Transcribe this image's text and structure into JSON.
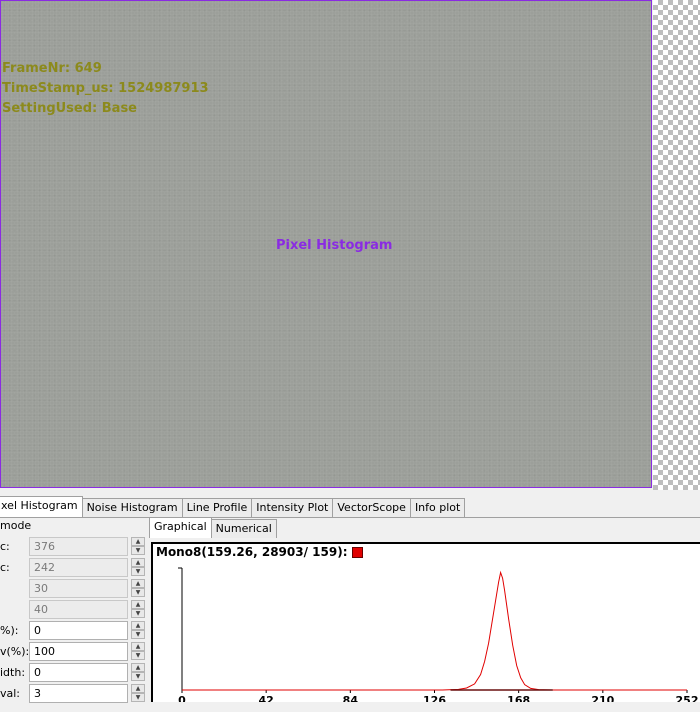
{
  "overlay": {
    "frame": "FrameNr: 649",
    "timestamp": "TimeStamp_us: 1524987913",
    "setting": "SettingUsed: Base",
    "title": "Pixel Histogram"
  },
  "tabs": [
    "xel Histogram",
    "Noise Histogram",
    "Line Profile",
    "Intensity Plot",
    "VectorScope",
    "Info plot"
  ],
  "settings": {
    "mode_label": "mode",
    "rows": [
      {
        "label": "c:",
        "value": "376",
        "disabled": true
      },
      {
        "label": "c:",
        "value": "242",
        "disabled": true
      },
      {
        "label": "",
        "value": "30",
        "disabled": true
      },
      {
        "label": "",
        "value": "40",
        "disabled": true
      },
      {
        "label": "%):",
        "value": "0",
        "disabled": false
      },
      {
        "label": "v(%):",
        "value": "100",
        "disabled": false
      },
      {
        "label": "idth:",
        "value": "0",
        "disabled": false
      },
      {
        "label": "val:",
        "value": "3",
        "disabled": false
      }
    ]
  },
  "subtabs": [
    "Graphical",
    "Numerical"
  ],
  "graph": {
    "title": "Mono8(159.26, 28903/  159):",
    "series_color": "#e00000"
  },
  "chart_data": {
    "type": "line",
    "title": "Mono8(159.26, 28903/  159):",
    "xlabel": "",
    "ylabel": "",
    "xlim": [
      0,
      252
    ],
    "ylim": [
      0,
      30000
    ],
    "xticks": [
      0,
      42,
      84,
      126,
      168,
      210,
      252
    ],
    "series": [
      {
        "x": [
          0,
          130,
          138,
          142,
          146,
          149,
          151,
          153,
          155,
          157,
          158,
          159,
          160,
          161,
          163,
          165,
          167,
          169,
          171,
          174,
          178,
          185,
          252
        ],
        "y": [
          0,
          0,
          150,
          500,
          1500,
          3800,
          7000,
          11500,
          17500,
          23500,
          26500,
          28903,
          27500,
          24500,
          17500,
          11000,
          6000,
          3000,
          1300,
          400,
          100,
          0,
          0
        ]
      }
    ]
  }
}
